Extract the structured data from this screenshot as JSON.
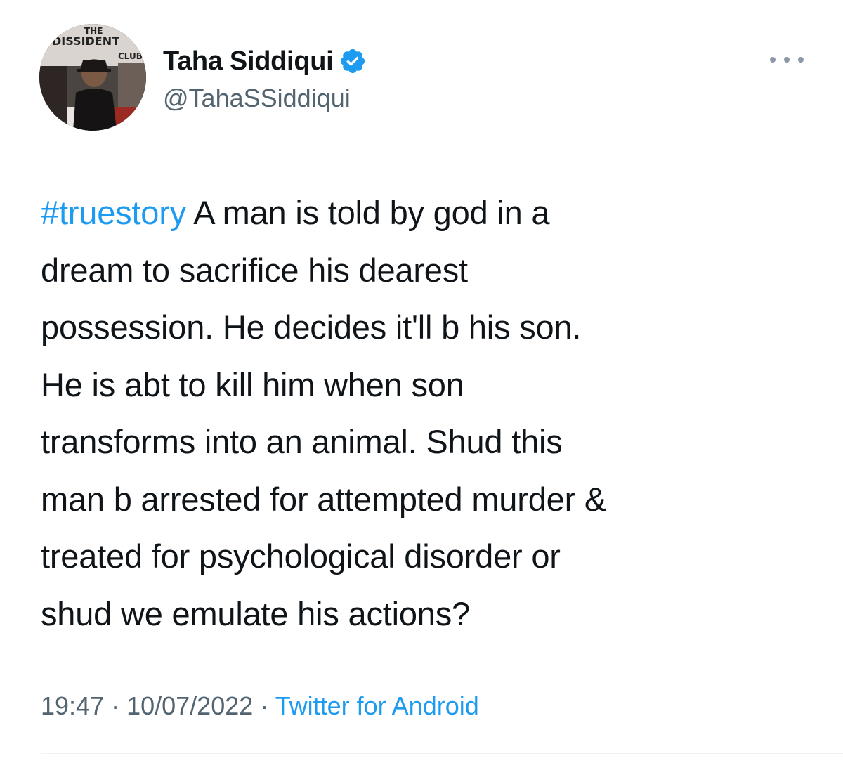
{
  "author": {
    "display_name": "Taha Siddiqui",
    "handle": "@TahaSSiddiqui",
    "verified": true
  },
  "avatar": {
    "sign_text": [
      "THE",
      "DISSIDENT",
      "CLUB"
    ]
  },
  "tweet": {
    "hashtag": "#truestory",
    "first_line_rest": " A man is told by god in a",
    "lines": [
      "dream to sacrifice his dearest",
      "possession. He decides it'll b his son.",
      "He is abt to kill him when son",
      "transforms into an animal. Shud this",
      "man b arrested for attempted murder &",
      "treated for psychological disorder or",
      "shud we emulate his actions?"
    ]
  },
  "meta": {
    "time": "19:47",
    "separator": " · ",
    "date": "10/07/2022",
    "source": "Twitter for Android"
  },
  "colors": {
    "accent": "#1d9bf0",
    "secondary_text": "#536471",
    "primary_text": "#0f1419"
  },
  "icons": {
    "verified": "verified-badge-icon",
    "more": "more-options-icon"
  }
}
